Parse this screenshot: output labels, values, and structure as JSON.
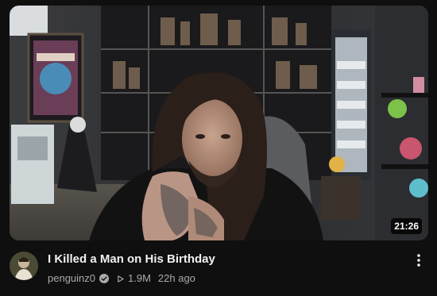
{
  "video": {
    "duration": "21:26",
    "title": "I Killed a Man on His Birthday",
    "channel": "penguinz0",
    "views": "1.9M",
    "age": "22h ago"
  },
  "icons": {
    "verified": "verified-check-icon",
    "views": "play-icon",
    "menu": "more-vert-icon"
  },
  "colors": {
    "background": "#0f0f0f",
    "title": "#f1f1f1",
    "secondary_text": "#aaaaaa",
    "duration_badge": "#000000"
  }
}
